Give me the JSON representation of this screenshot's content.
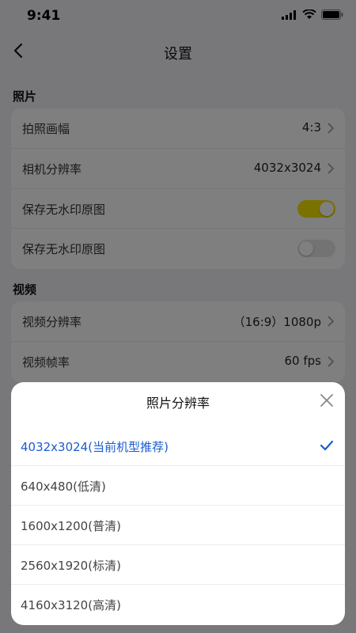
{
  "status_bar": {
    "time": "9:41"
  },
  "nav": {
    "title": "设置"
  },
  "photo": {
    "title": "照片",
    "rows": [
      {
        "label": "拍照画幅",
        "value": "4:3"
      },
      {
        "label": "相机分辨率",
        "value": "4032x3024"
      },
      {
        "label": "保存无水印原图",
        "toggle": "on"
      },
      {
        "label": "保存无水印原图",
        "toggle": "off"
      }
    ]
  },
  "video": {
    "title": "视频",
    "rows": [
      {
        "label": "视频分辨率",
        "value": "（16:9）1080p"
      },
      {
        "label": "视频帧率",
        "value": "60 fps"
      }
    ]
  },
  "sheet": {
    "title": "照片分辨率",
    "options": [
      {
        "label": "4032x3024(当前机型推荐)",
        "selected": true
      },
      {
        "label": "640x480(低清)",
        "selected": false
      },
      {
        "label": "1600x1200(普清)",
        "selected": false
      },
      {
        "label": "2560x1920(标清)",
        "selected": false
      },
      {
        "label": "4160x3120(高清)",
        "selected": false
      }
    ]
  },
  "colors": {
    "accent": "#1a5bd0",
    "toggle_on": "#f2e200",
    "overlay": "rgba(0,0,0,0.5)"
  }
}
